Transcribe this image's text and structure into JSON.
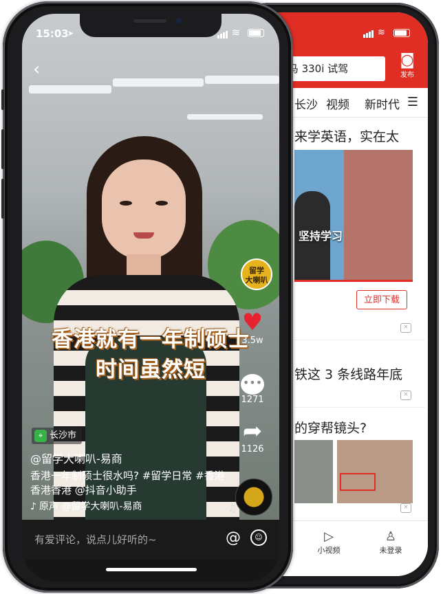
{
  "back_phone": {
    "search_text": "| 宝马 330i 试驾",
    "camera_label": "发布",
    "tabs": [
      "长沙",
      "视频",
      "新时代"
    ],
    "articles": [
      {
        "title": "来学英语，实在太"
      },
      {
        "title": "铁这 3 条线路年底"
      },
      {
        "title": "的穿帮镜头?"
      }
    ],
    "thumb_caption": "坚持学习",
    "download_label": "立即下载",
    "close_glyph": "×",
    "tabbar": [
      {
        "label": "小视频",
        "icon": "play-icon"
      },
      {
        "label": "未登录",
        "icon": "user-icon"
      }
    ]
  },
  "front_phone": {
    "status": {
      "time": "15:03",
      "arrow": "➤"
    },
    "back_glyph": "‹",
    "badge": "留学\n大喇叭",
    "subtitle_line1": "香港就有一年制硕士",
    "subtitle_line2": "时间虽然短",
    "likes": "3.5w",
    "comments": "1271",
    "shares": "1126",
    "location": "长沙市",
    "author": "@留学大喇叭-易商",
    "caption": "香港一年制硕士很水吗? #留学日常 #香港香港香港 @抖音小助手",
    "music_note": "♪",
    "music": "原声 @留学大喇叭-易商",
    "comment_placeholder": "有爱评论，说点儿好听的~",
    "at_glyph": "@",
    "emoji_glyph": "☺",
    "heart_glyph": "♥",
    "comment_glyph": "•••",
    "share_glyph": "➦",
    "pin_glyph": "⌖"
  }
}
